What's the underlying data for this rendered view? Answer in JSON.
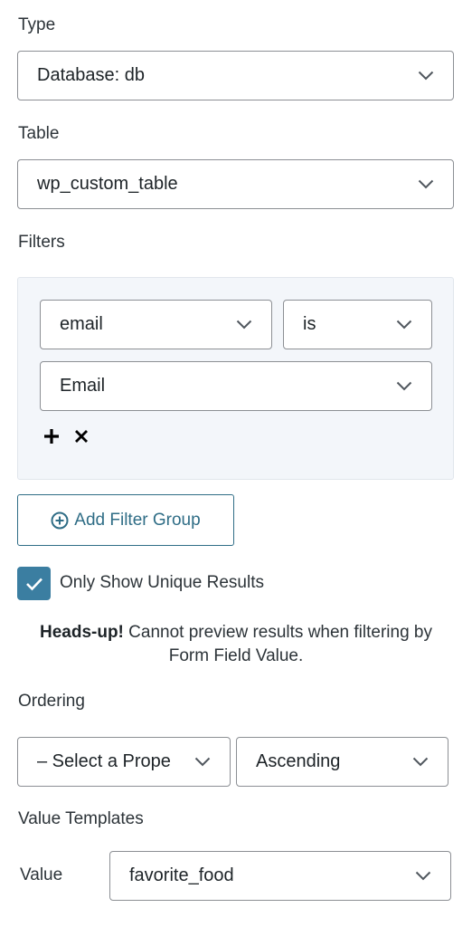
{
  "type_section": {
    "label": "Type",
    "selected": "Database: db"
  },
  "table_section": {
    "label": "Table",
    "selected": "wp_custom_table"
  },
  "filters_section": {
    "label": "Filters",
    "field_select": "email",
    "operator_select": "is",
    "value_select": "Email",
    "add_icon": "plus-icon",
    "remove_icon": "close-icon"
  },
  "add_filter_group": {
    "icon": "plus-circle-icon",
    "label": "Add Filter Group"
  },
  "unique_results": {
    "checked": true,
    "label": "Only Show Unique Results"
  },
  "notice": {
    "strong": "Heads-up!",
    "text": " Cannot preview results when filtering by Form Field Value."
  },
  "ordering_section": {
    "label": "Ordering",
    "property_select": "– Select a Prope",
    "direction_select": "Ascending"
  },
  "value_templates_section": {
    "label": "Value Templates",
    "value_label": "Value",
    "value_select": "favorite_food"
  },
  "colors": {
    "accent": "#3b7ea1",
    "button_text": "#2f6d86",
    "filters_bg": "#f3f6fa",
    "border": "#8c8f94"
  }
}
